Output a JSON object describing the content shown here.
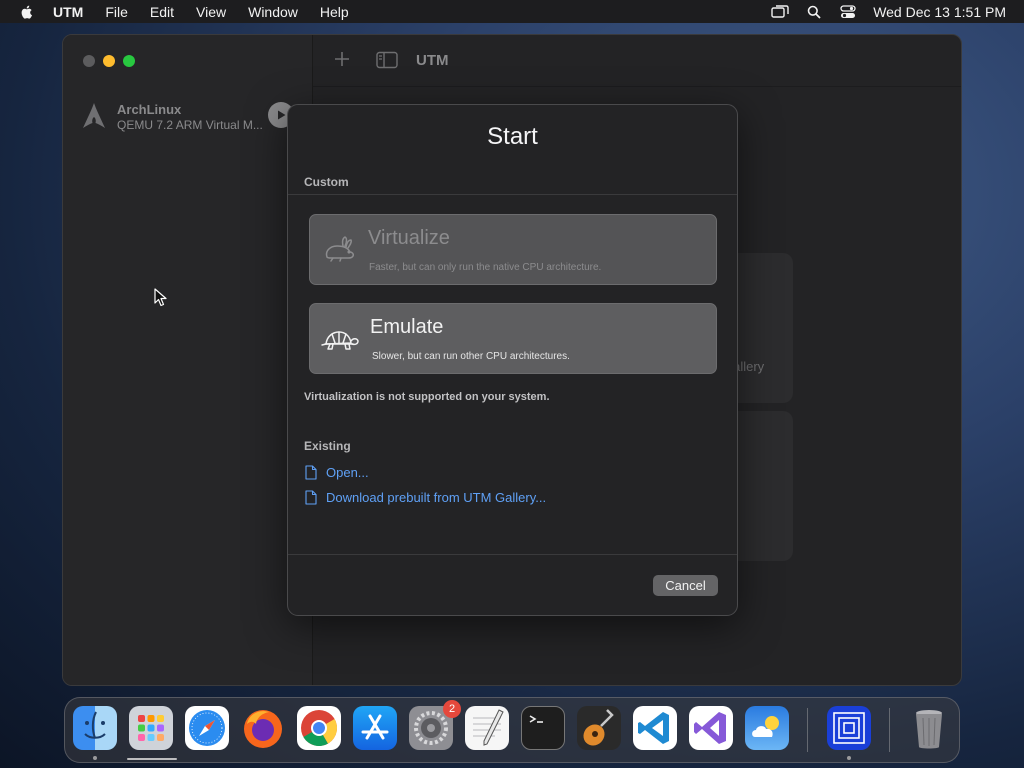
{
  "menubar": {
    "app_name": "UTM",
    "items": [
      "File",
      "Edit",
      "View",
      "Window",
      "Help"
    ],
    "clock": "Wed Dec 13  1:51 PM",
    "status_icons": [
      "screen-mirroring-icon",
      "search-icon",
      "control-center-icon"
    ]
  },
  "window": {
    "toolbar": {
      "title": "UTM"
    },
    "sidebar": {
      "vm": {
        "name": "ArchLinux",
        "subtitle": "QEMU 7.2 ARM Virtual M..."
      }
    },
    "background": {
      "gallery_fragment": "Gallery"
    }
  },
  "dialog": {
    "title": "Start",
    "custom_label": "Custom",
    "options": [
      {
        "title": "Virtualize",
        "description": "Faster, but can only run the native CPU architecture.",
        "enabled": false,
        "icon": "rabbit-icon"
      },
      {
        "title": "Emulate",
        "description": "Slower, but can run other CPU architectures.",
        "enabled": true,
        "icon": "turtle-icon"
      }
    ],
    "notice": "Virtualization is not supported on your system.",
    "existing_label": "Existing",
    "links": [
      {
        "label": "Open...",
        "icon": "document-icon"
      },
      {
        "label": "Download prebuilt from UTM Gallery...",
        "icon": "document-icon"
      }
    ],
    "cancel_label": "Cancel"
  },
  "dock": {
    "apps": [
      "Finder",
      "Launchpad",
      "Safari",
      "Firefox",
      "Chrome",
      "App Store",
      "System Settings",
      "TextEdit",
      "Terminal",
      "GarageBand",
      "Visual Studio Code",
      "Visual Studio",
      "Weather",
      "UTM",
      "Trash"
    ],
    "settings_badge": "2"
  },
  "colors": {
    "link": "#5fa0f5",
    "accent_close": "#5c5c5e",
    "accent_min": "#febc2e",
    "accent_max": "#28c840"
  }
}
